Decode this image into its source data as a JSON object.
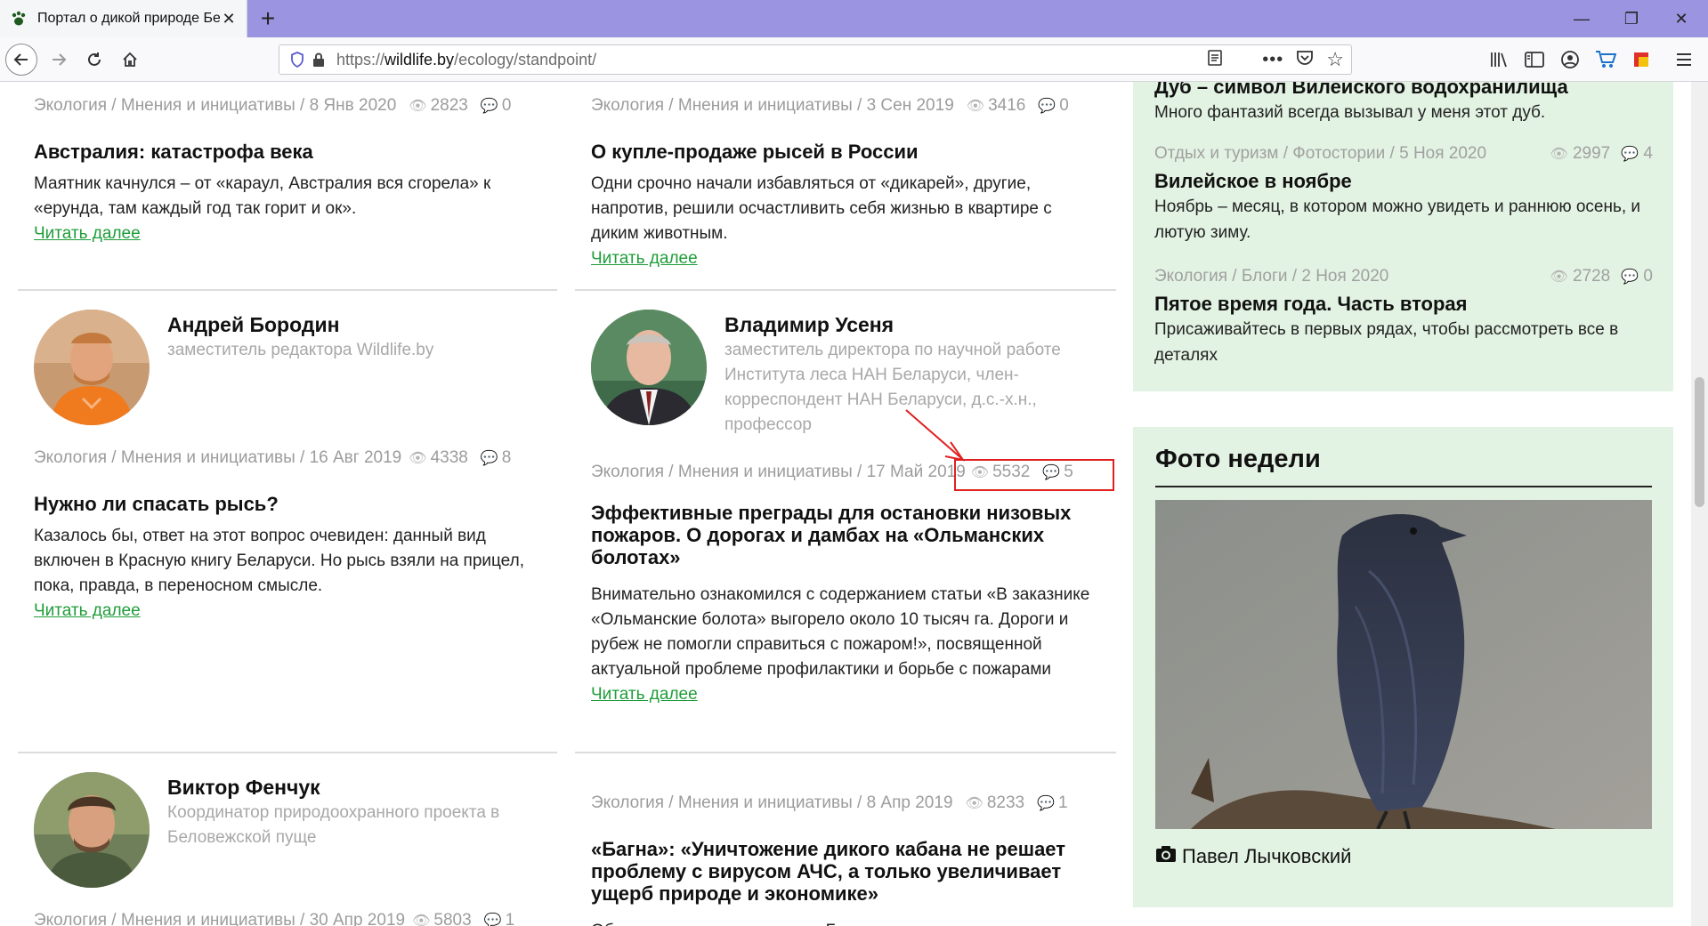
{
  "browser": {
    "tab_title": "Портал о дикой природе Бел",
    "url_prefix": "https://",
    "url_host": "wildlife.by",
    "url_path": "/ecology/standpoint/"
  },
  "left_column": {
    "card1": {
      "meta": "Экология / Мнения и инициативы / 8 Янв 2020",
      "views": "2823",
      "comments": "0",
      "title": "Австралия: катастрофа века",
      "excerpt": "Маятник качнулся – от «караул, Австралия вся сгорела» к «ерунда, там каждый год так горит и ок».",
      "read_more": "Читать далее"
    },
    "card2": {
      "author_name": "Андрей Бородин",
      "author_role": "заместитель редактора Wildlife.by",
      "meta": "Экология / Мнения и инициативы / 16 Авг 2019",
      "views": "4338",
      "comments": "8",
      "title": "Нужно ли спасать рысь?",
      "excerpt": "Казалось бы, ответ на этот вопрос очевиден: данный вид включен в Красную книгу Беларуси. Но рысь взяли на прицел, пока, правда, в переносном смысле.",
      "read_more": "Читать далее"
    },
    "card3": {
      "author_name": "Виктор Фенчук",
      "author_role": "Координатор природоохранного проекта в Беловежской пуще",
      "meta": "Экология / Мнения и инициативы / 30 Апр 2019",
      "views": "5803",
      "comments": "1"
    }
  },
  "middle_column": {
    "card1": {
      "meta": "Экология / Мнения и инициативы / 3 Сен 2019",
      "views": "3416",
      "comments": "0",
      "title": "О купле-продаже рысей в России",
      "excerpt": "Одни срочно начали избавляться от «дикарей», другие, напротив, решили осчастливить себя жизнью в квартире с диким животным.",
      "read_more": "Читать далее"
    },
    "card2": {
      "author_name": "Владимир Усеня",
      "author_role": "заместитель директора по научной работе Института леса НАН Беларуси, член-корреспондент НАН Беларуси, д.с.-х.н., профессор",
      "meta": "Экология / Мнения и инициативы / 17 Май 2019",
      "views": "5532",
      "comments": "5",
      "title": "Эффективные преграды для остановки низовых пожаров. О дорогах и дамбах на «Ольманских болотах»",
      "excerpt": "Внимательно ознакомился с содержанием статьи «В заказнике «Ольманские болота» выгорело около 10 тысяч га. Дороги и рубеж не помогли справиться с пожаром!», посвященной актуальной проблеме профилактики и борьбе с пожарами",
      "read_more": "Читать далее"
    },
    "card3": {
      "meta": "Экология / Мнения и инициативы / 8 Апр 2019",
      "views": "8233",
      "comments": "1",
      "title": "«Багна»: «Уничтожение дикого кабана не решает проблему с вирусом АЧС, а только увеличивает ущерб природе и экономике»",
      "excerpt": "Общественная организация «Багна» представляет свою"
    }
  },
  "sidebar": {
    "items": [
      {
        "title": "Дуб – символ Вилейского водохранилища",
        "text": "Много фантазий всегда вызывал у меня этот дуб."
      },
      {
        "meta": "Отдых и туризм / Фотостории / 5 Ноя 2020",
        "views": "2997",
        "comments": "4",
        "title": "Вилейское в ноябре",
        "text": "Ноябрь – месяц, в котором можно увидеть и раннюю осень, и лютую зиму."
      },
      {
        "meta": "Экология / Блоги / 2 Ноя 2020",
        "views": "2728",
        "comments": "0",
        "title": "Пятое время года. Часть вторая",
        "text": "Присаживайтесь в первых рядах, чтобы рассмотреть все в деталях"
      }
    ],
    "photo_week": {
      "heading": "Фото недели",
      "author": "Павел Лычковский"
    }
  },
  "colors": {
    "accent_link": "#1f9d3a",
    "sidebar_bg": "#e3f3e3",
    "highlight": "#e02020",
    "tabbar": "#9b94e0"
  }
}
